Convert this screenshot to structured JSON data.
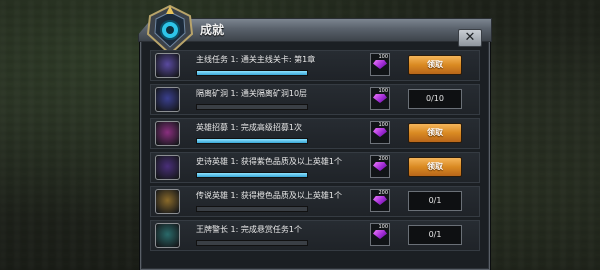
{
  "window": {
    "title": "成就"
  },
  "colors": {
    "claim": "#d98a22",
    "bar": "#3aa6d6",
    "gem": "#b33ee3"
  },
  "achievements": [
    {
      "title": "主线任务 1: 通关主线关卡: 第1章",
      "progress": 1.0,
      "reward_qty": "100",
      "action": "claim",
      "action_label": "领取",
      "icon": "skull-crest-icon",
      "icon_bg": "#5a4aa0"
    },
    {
      "title": "隔离矿洞 1: 通关隔离矿洞10层",
      "progress": 0.0,
      "reward_qty": "100",
      "action": "progress",
      "action_label": "0/10",
      "icon": "mine-badge-icon",
      "icon_bg": "#3a3f8f"
    },
    {
      "title": "英雄招募 1: 完成高级招募1次",
      "progress": 1.0,
      "reward_qty": "100",
      "action": "claim",
      "action_label": "领取",
      "icon": "demon-face-icon",
      "icon_bg": "#8a2f7f"
    },
    {
      "title": "史诗英雄 1: 获得紫色品质及以上英雄1个",
      "progress": 1.0,
      "reward_qty": "200",
      "action": "claim",
      "action_label": "领取",
      "icon": "hero-silhouette-icon",
      "icon_bg": "#4a2f7a"
    },
    {
      "title": "传说英雄 1: 获得橙色品质及以上英雄1个",
      "progress": 0.0,
      "reward_qty": "200",
      "action": "progress",
      "action_label": "0/1",
      "icon": "legend-star-icon",
      "icon_bg": "#8a6a2a"
    },
    {
      "title": "王牌警长 1: 完成悬赏任务1个",
      "progress": 0.0,
      "reward_qty": "100",
      "action": "progress",
      "action_label": "0/1",
      "icon": "sheriff-badge-icon",
      "icon_bg": "#2a6a6a"
    }
  ]
}
